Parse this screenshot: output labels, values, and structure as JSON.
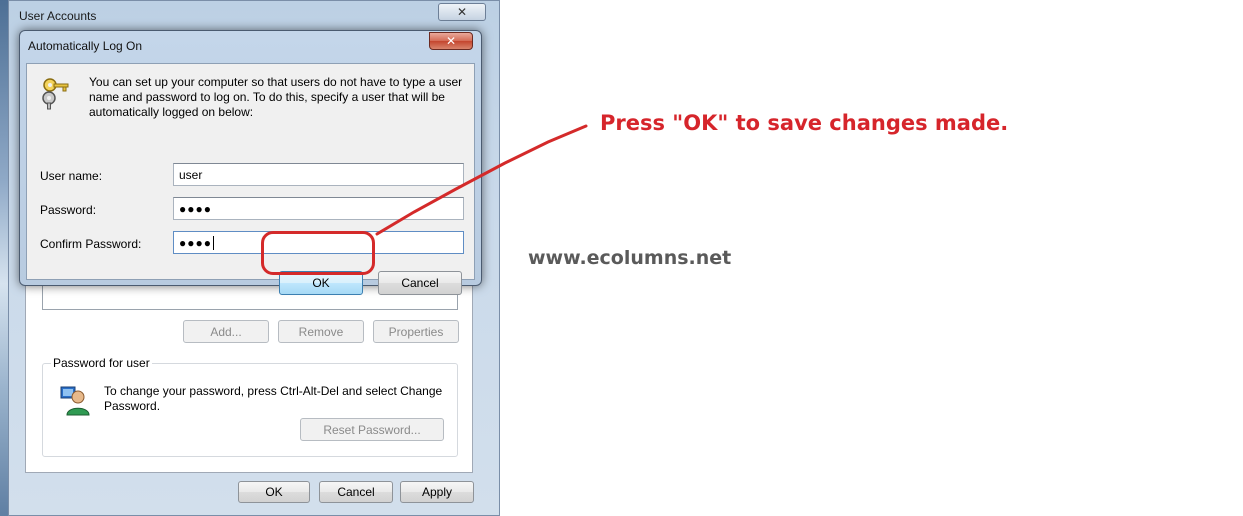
{
  "user_accounts": {
    "title": "User Accounts",
    "close_glyph": "✕",
    "buttons": {
      "add": "Add...",
      "remove": "Remove",
      "properties": "Properties"
    },
    "password_group": {
      "label": "Password for user",
      "text": "To change your password, press Ctrl-Alt-Del and select Change Password.",
      "reset_button": "Reset Password..."
    },
    "footer": {
      "ok": "OK",
      "cancel": "Cancel",
      "apply": "Apply"
    }
  },
  "auto_logon": {
    "title": "Automatically Log On",
    "close_glyph": "✕",
    "intro": "You can set up your computer so that users do not have to type a user name and password to log on. To do this, specify a user that will be automatically logged on below:",
    "fields": {
      "username": {
        "label": "User name:",
        "value": "user"
      },
      "password": {
        "label": "Password:",
        "value": "●●●●"
      },
      "confirm": {
        "label": "Confirm Password:",
        "value": "●●●●"
      }
    },
    "ok": "OK",
    "cancel": "Cancel"
  },
  "annotation": {
    "instruction": "Press \"OK\" to save changes made.",
    "color": "#d6252b"
  },
  "watermark": "www.ecolumns.net",
  "icons": [
    "keys-icon",
    "user-icon",
    "close-icon"
  ]
}
